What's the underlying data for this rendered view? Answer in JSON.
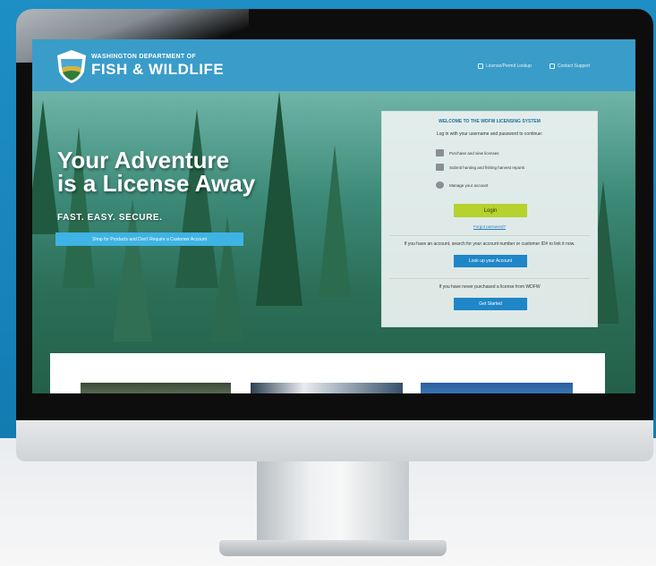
{
  "site": {
    "brand_small": "WASHINGTON DEPARTMENT OF",
    "brand_big": "FISH & WILDLIFE",
    "header_links": [
      "License/Permit Lookup",
      "Contact Support"
    ]
  },
  "hero": {
    "title_line1": "Your Adventure",
    "title_line2": "is a License Away",
    "subtitle": "FAST. EASY. SECURE.",
    "cta": "Shop for Products and Don't Require a Customer Account"
  },
  "login": {
    "title": "WELCOME TO THE WDFW LICENSING SYSTEM",
    "prompt": "Log in with your username and password to continue:",
    "features": [
      {
        "icon": "calendar-icon",
        "text": "Purchase and view licenses"
      },
      {
        "icon": "trophy-icon",
        "text": "Submit hunting and fishing harvest reports"
      },
      {
        "icon": "user-icon",
        "text": "Manage your account"
      }
    ],
    "login_label": "Login",
    "forgot_label": "Forgot password?",
    "existing_text": "If you have an account, search for your account number or customer ID# to link it now.",
    "lookup_label": "Look up your Account",
    "new_text": "If you have never purchased a license from WDFW",
    "get_started_label": "Get Started"
  }
}
